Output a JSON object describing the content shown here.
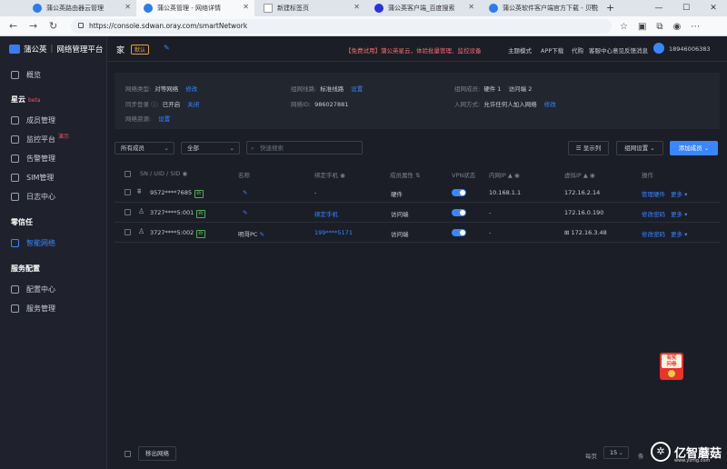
{
  "browser": {
    "tabs": [
      {
        "label": "蒲公英路由器云管理"
      },
      {
        "label": "蒲公英管理 - 网络详情"
      },
      {
        "label": "新建标签页"
      },
      {
        "label": "蒲公英客户端_百度搜索"
      },
      {
        "label": "蒲公英软件客户端官方下载 - 贝锐"
      }
    ],
    "url": "https://console.sdwan.oray.com/smartNetwork"
  },
  "sidebar": {
    "brand": "蒲公英",
    "brand_sub": "网络管理平台",
    "overview": "概览",
    "section_star": "星云",
    "section_star_badge": "beta",
    "member_mgmt": "成员管理",
    "monitor": "监控平台",
    "monitor_badge": "演示",
    "alarm": "告警管理",
    "sim": "SIM管理",
    "log": "日志中心",
    "section_zero": "零信任",
    "smart_network": "智能网络",
    "section_service": "服务配置",
    "config_center": "配置中心",
    "service_mgmt": "服务管理"
  },
  "topbar": {
    "title": "家",
    "badge": "默认",
    "promo": "【免费试用】蒲公英星云，体验批量管理、监控设备",
    "links": [
      "主题模式",
      "APP下载",
      "代购",
      "客服中心",
      "意见反馈",
      "消息"
    ],
    "user": "18946006383"
  },
  "info": {
    "type_label": "网络类型:",
    "type_value": "对等网络",
    "type_action": "修改",
    "line_label": "组网线路:",
    "line_value": "标准线路",
    "line_action": "设置",
    "member_label": "组网成员:",
    "member_value": "硬件 1    访问端 2",
    "sync_label": "同步登录 ⓘ:",
    "sync_value": "已开启",
    "sync_action": "关闭",
    "id_label": "网络ID:",
    "id_value": "986027881",
    "join_label": "入网方式:",
    "join_value": "允许任何人加入网络",
    "join_action": "修改",
    "resource_label": "网络资源:",
    "resource_action": "设置"
  },
  "toolbar": {
    "filter_members": "所有成员",
    "filter_all": "全部",
    "search_placeholder": "快速搜索",
    "show_columns": "显示列",
    "network_settings": "组网设置",
    "add_member": "添加成员"
  },
  "table": {
    "headers": {
      "sn": "SN / UID / SID",
      "name": "名称",
      "phone": "绑定手机",
      "attr": "成员属性",
      "vpn": "VPN状态",
      "lan_ip": "内网IP",
      "virtual_ip": "虚拟IP",
      "ops": "操作"
    },
    "rows": [
      {
        "sn": "9572****7685",
        "tag": "新",
        "name": "",
        "phone": "-",
        "attr": "硬件",
        "lan_ip": "10.168.1.1",
        "virtual_ip": "172.16.2.14",
        "op1": "管理硬件",
        "op2": "更多"
      },
      {
        "sn": "3727****5:001",
        "tag": "新",
        "name": "",
        "phone": "绑定手机",
        "attr": "访问端",
        "lan_ip": "-",
        "virtual_ip": "172.16.0.190",
        "op1": "修改密码",
        "op2": "更多"
      },
      {
        "sn": "3727****5:002",
        "tag": "新",
        "name": "明哥PC",
        "phone": "199****5171",
        "attr": "访问端",
        "lan_ip": "-",
        "virtual_ip": "172.16.3.48",
        "op1": "修改密码",
        "op2": "更多"
      }
    ]
  },
  "footer": {
    "remove": "移出网络",
    "per_page": "每页",
    "page_size": "15",
    "unit": "条"
  },
  "redpack": {
    "line1": "有奖",
    "line2": "问卷"
  },
  "watermark": {
    "text": "亿智蘑菇",
    "sub": "www.yzmg.com"
  },
  "colors": {
    "accent": "#3a86ff",
    "bg": "#1b1e27",
    "promo": "#f56c6c",
    "new_tag": "#4caf50"
  }
}
